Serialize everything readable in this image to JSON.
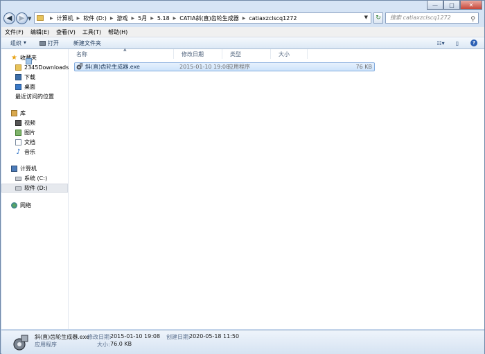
{
  "window": {
    "buttons": {
      "minimize": "—",
      "maximize": "□",
      "close": "✕"
    }
  },
  "address": {
    "crumbs": [
      "计算机",
      "软件 (D:)",
      "游戏",
      "5月",
      "5.18",
      "CATIA斜(直)齿轮生成器",
      "catiaxzclscq1272"
    ],
    "refresh_icon": "refresh-icon"
  },
  "search": {
    "placeholder": "搜索 catiaxzclscq1272"
  },
  "menubar": {
    "items": [
      "文件(F)",
      "编辑(E)",
      "查看(V)",
      "工具(T)",
      "帮助(H)"
    ]
  },
  "toolbar": {
    "organize": "组织",
    "open": "打开",
    "new_folder": "新建文件夹"
  },
  "nav": {
    "favorites": {
      "title": "收藏夹",
      "items": [
        "2345Downloads",
        "下载",
        "桌面",
        "最近访问的位置"
      ]
    },
    "libraries": {
      "title": "库",
      "items": [
        "视频",
        "图片",
        "文档",
        "音乐"
      ]
    },
    "computer": {
      "title": "计算机",
      "items": [
        "系统 (C:)",
        "软件 (D:)"
      ]
    },
    "network": {
      "title": "网络"
    }
  },
  "columns": {
    "name": "名称",
    "modified": "修改日期",
    "type": "类型",
    "size": "大小"
  },
  "files": [
    {
      "name": "斜(直)齿轮生成器.exe",
      "modified": "2015-01-10 19:08",
      "type": "应用程序",
      "size": "76 KB"
    }
  ],
  "details": {
    "filename": "斜(直)齿轮生成器.exe",
    "filetype": "应用程序",
    "modified_label": "修改日期:",
    "modified_value": "2015-01-10 19:08",
    "created_label": "创建日期:",
    "created_value": "2020-05-18 11:50",
    "size_label": "大小:",
    "size_value": "76.0 KB"
  }
}
